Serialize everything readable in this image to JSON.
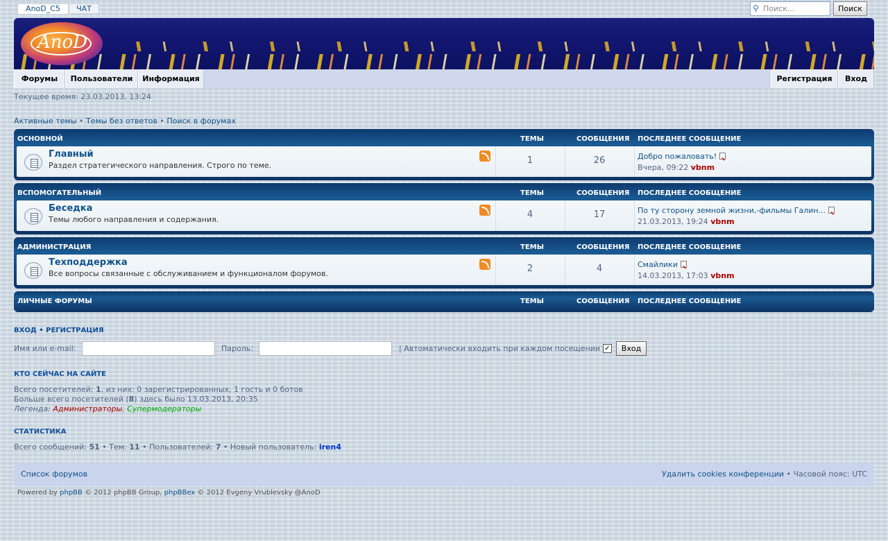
{
  "top": {
    "tab1": "AnoD_C5",
    "tab2": "ЧАТ",
    "search_placeholder": "Поиск...",
    "search_button": "Поиск"
  },
  "logo_text": "AnoD",
  "nav": {
    "forums": "Форумы",
    "users": "Пользователи",
    "info": "Информация",
    "register": "Регистрация",
    "login": "Вход"
  },
  "current_time": "Текущее время: 23.03.2013, 13:24",
  "quick_links": {
    "active": "Активные темы",
    "unanswered": "Темы без ответов",
    "search": "Поиск в форумах",
    "sep": " • "
  },
  "col_topics": "ТЕМЫ",
  "col_posts": "СООБЩЕНИЯ",
  "col_last": "ПОСЛЕДНЕЕ СООБЩЕНИЕ",
  "categories": [
    {
      "name": "ОСНОВНОЙ",
      "forum": {
        "title": "Главный",
        "desc": "Раздел стратегического направления. Строго по теме.",
        "topics": "1",
        "posts": "26",
        "last_title": "Добро пожаловать!",
        "last_date": "Вчера, 09:22",
        "last_user": "vbnm"
      }
    },
    {
      "name": "ВСПОМОГАТЕЛЬНЫЙ",
      "forum": {
        "title": "Беседка",
        "desc": "Темы любого направления и содержания.",
        "topics": "4",
        "posts": "17",
        "last_title": "По ту сторону земной жизни,-фильмы Галин...",
        "last_date": "21.03.2013, 19:24",
        "last_user": "vbnm"
      }
    },
    {
      "name": "АДМИНИСТРАЦИЯ",
      "forum": {
        "title": "Техподдержка",
        "desc": "Все вопросы связанные с обслуживанием и функционалом форумов.",
        "topics": "2",
        "posts": "4",
        "last_title": "Смайлики",
        "last_date": "14.03.2013, 17:03",
        "last_user": "vbnm"
      }
    },
    {
      "name": "ЛИЧНЫЕ ФОРУМЫ"
    }
  ],
  "login": {
    "h_login": "ВХОД",
    "h_sep": " • ",
    "h_register": "РЕГИСТРАЦИЯ",
    "user_label": "Имя или e-mail:",
    "pass_label": "Пароль:",
    "autologin": "| Автоматически входить при каждом посещении",
    "checkbox": "✓",
    "button": "Вход"
  },
  "online": {
    "heading": "КТО СЕЙЧАС НА САЙТЕ",
    "line1_a": "Всего посетителей: ",
    "line1_n": "1",
    "line1_b": ", из них: 0 зарегистрированных, 1 гость и 0 ботов",
    "line2_a": "Больше всего посетителей (",
    "line2_n": "8",
    "line2_b": ") здесь было 13.03.2013, 20:35",
    "legend_label": "Легенда: ",
    "legend_admin": "Администраторы",
    "legend_comma": ", ",
    "legend_mod": "Супермодераторы",
    "extra": "(по активности за 5 минут)"
  },
  "stats": {
    "heading": "СТАТИСТИКА",
    "a": "Всего сообщений: ",
    "posts": "51",
    "b": " • Тем: ",
    "topics": "11",
    "c": " • Пользователей: ",
    "users": "7",
    "d": " • Новый пользователь: ",
    "newuser": "iren4"
  },
  "footer": {
    "index": "Список форумов",
    "delete_cookies": "Удалить cookies конференции",
    "tz": " • Часовой пояс: UTC"
  },
  "powered": {
    "a": "Powered by ",
    "phpbb": "phpBB",
    "b": " © 2012 phpBB Group, ",
    "phpbbex": "phpBBex",
    "c": " © 2012 Evgeny Vrublevsky @AnoD"
  },
  "colors": {
    "admin": "#aa0000",
    "supermod": "#00aa00",
    "link": "#105289",
    "newuser": "#0033cc"
  }
}
